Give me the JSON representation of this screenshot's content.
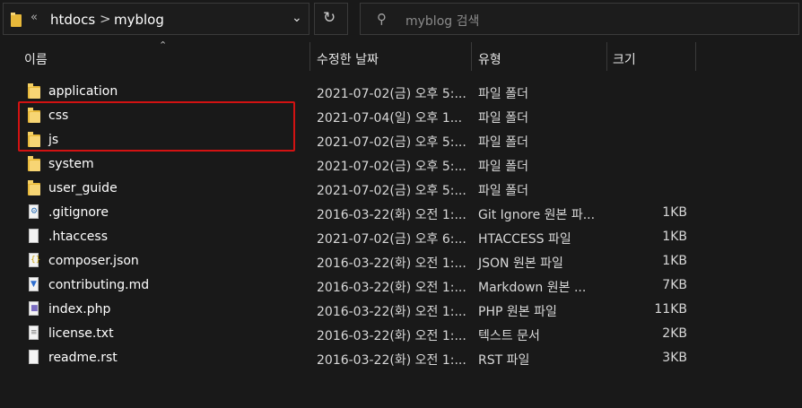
{
  "address_bar": {
    "overflow_chevron": "«",
    "crumbs": [
      "htdocs",
      "myblog"
    ],
    "separator": ">"
  },
  "search": {
    "placeholder": "myblog 검색"
  },
  "columns": {
    "name": "이름",
    "date": "수정한 날짜",
    "type": "유형",
    "size": "크기"
  },
  "files": [
    {
      "name": "application",
      "date": "2021-07-02(금) 오후 5:...",
      "type": "파일 폴더",
      "size": "",
      "icon": "folder-icon"
    },
    {
      "name": "css",
      "date": "2021-07-04(일) 오후 1...",
      "type": "파일 폴더",
      "size": "",
      "icon": "folder-icon"
    },
    {
      "name": "js",
      "date": "2021-07-02(금) 오후 5:...",
      "type": "파일 폴더",
      "size": "",
      "icon": "folder-icon"
    },
    {
      "name": "system",
      "date": "2021-07-02(금) 오후 5:...",
      "type": "파일 폴더",
      "size": "",
      "icon": "folder-icon"
    },
    {
      "name": "user_guide",
      "date": "2021-07-02(금) 오후 5:...",
      "type": "파일 폴더",
      "size": "",
      "icon": "folder-icon"
    },
    {
      "name": ".gitignore",
      "date": "2016-03-22(화) 오전 1:...",
      "type": "Git Ignore 원본 파...",
      "size": "1KB",
      "icon": "gear-file-icon"
    },
    {
      "name": ".htaccess",
      "date": "2021-07-02(금) 오후 6:...",
      "type": "HTACCESS 파일",
      "size": "1KB",
      "icon": "file-icon"
    },
    {
      "name": "composer.json",
      "date": "2016-03-22(화) 오전 1:...",
      "type": "JSON 원본 파일",
      "size": "1KB",
      "icon": "json-file-icon"
    },
    {
      "name": "contributing.md",
      "date": "2016-03-22(화) 오전 1:...",
      "type": "Markdown 원본 ...",
      "size": "7KB",
      "icon": "markdown-file-icon"
    },
    {
      "name": "index.php",
      "date": "2016-03-22(화) 오전 1:...",
      "type": "PHP 원본 파일",
      "size": "11KB",
      "icon": "php-file-icon"
    },
    {
      "name": "license.txt",
      "date": "2016-03-22(화) 오전 1:...",
      "type": "텍스트 문서",
      "size": "2KB",
      "icon": "text-file-icon"
    },
    {
      "name": "readme.rst",
      "date": "2016-03-22(화) 오전 1:...",
      "type": "RST 파일",
      "size": "3KB",
      "icon": "file-icon"
    }
  ],
  "colors": {
    "background": "#191919",
    "folder": "#e8b93a",
    "highlight": "#d21212"
  }
}
